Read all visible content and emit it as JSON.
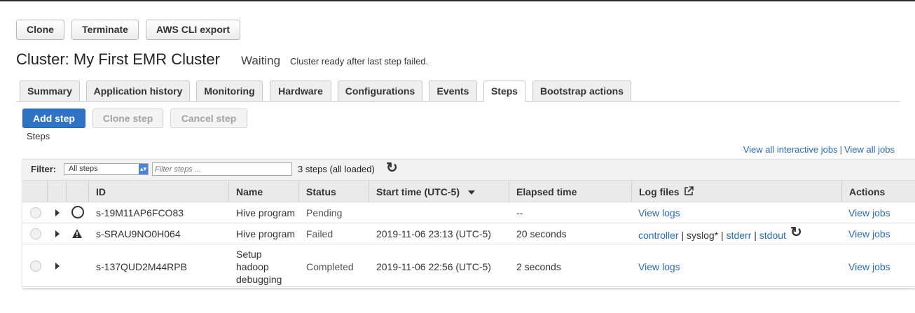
{
  "toolbar": {
    "clone_label": "Clone",
    "terminate_label": "Terminate",
    "aws_cli_export_label": "AWS CLI export"
  },
  "cluster": {
    "title": "Cluster: My First EMR Cluster",
    "state": "Waiting",
    "state_message": "Cluster ready after last step failed."
  },
  "tabs": [
    {
      "label": "Summary"
    },
    {
      "label": "Application history"
    },
    {
      "label": "Monitoring"
    },
    {
      "label": "Hardware"
    },
    {
      "label": "Configurations"
    },
    {
      "label": "Events"
    },
    {
      "label": "Steps",
      "active": true
    },
    {
      "label": "Bootstrap actions"
    }
  ],
  "step_actions": {
    "add_step": "Add step",
    "clone_step": "Clone step",
    "cancel_step": "Cancel step"
  },
  "steps_label": "Steps",
  "links": {
    "interactive_jobs": "View all interactive jobs",
    "separator": "|",
    "all_jobs": "View all jobs"
  },
  "filter": {
    "label": "Filter:",
    "selected": "All steps",
    "placeholder": "Filter steps ...",
    "count_text": "3 steps (all loaded)",
    "refresh_icon": "refresh-icon"
  },
  "columns": {
    "id": "ID",
    "name": "Name",
    "status": "Status",
    "start_time": "Start time (UTC-5)",
    "elapsed_time": "Elapsed time",
    "log_files": "Log files",
    "actions": "Actions"
  },
  "rows": [
    {
      "status_icon": "pending-circle-icon",
      "id": "s-19M11AP6FCO83",
      "name": "Hive program",
      "status": "Pending",
      "start_time": "",
      "elapsed_time": "--",
      "log": "View logs",
      "action": "View jobs"
    },
    {
      "status_icon": "warning-triangle-icon",
      "id": "s-SRAU9NO0H064",
      "name": "Hive program",
      "status": "Failed",
      "start_time": "2019-11-06 23:13 (UTC-5)",
      "elapsed_time": "20 seconds",
      "log_links": [
        "controller",
        "syslog*",
        "stderr",
        "stdout"
      ],
      "log_sep": "|",
      "action": "View jobs"
    },
    {
      "status_icon": "",
      "id": "s-137QUD2M44RPB",
      "name_lines": [
        "Setup",
        "hadoop",
        "debugging"
      ],
      "status": "Completed",
      "start_time": "2019-11-06 22:56 (UTC-5)",
      "elapsed_time": "2 seconds",
      "log": "View logs",
      "action": "View jobs"
    }
  ],
  "colors": {
    "primary_button": "#2f73c2",
    "link": "#2a6ab4"
  }
}
